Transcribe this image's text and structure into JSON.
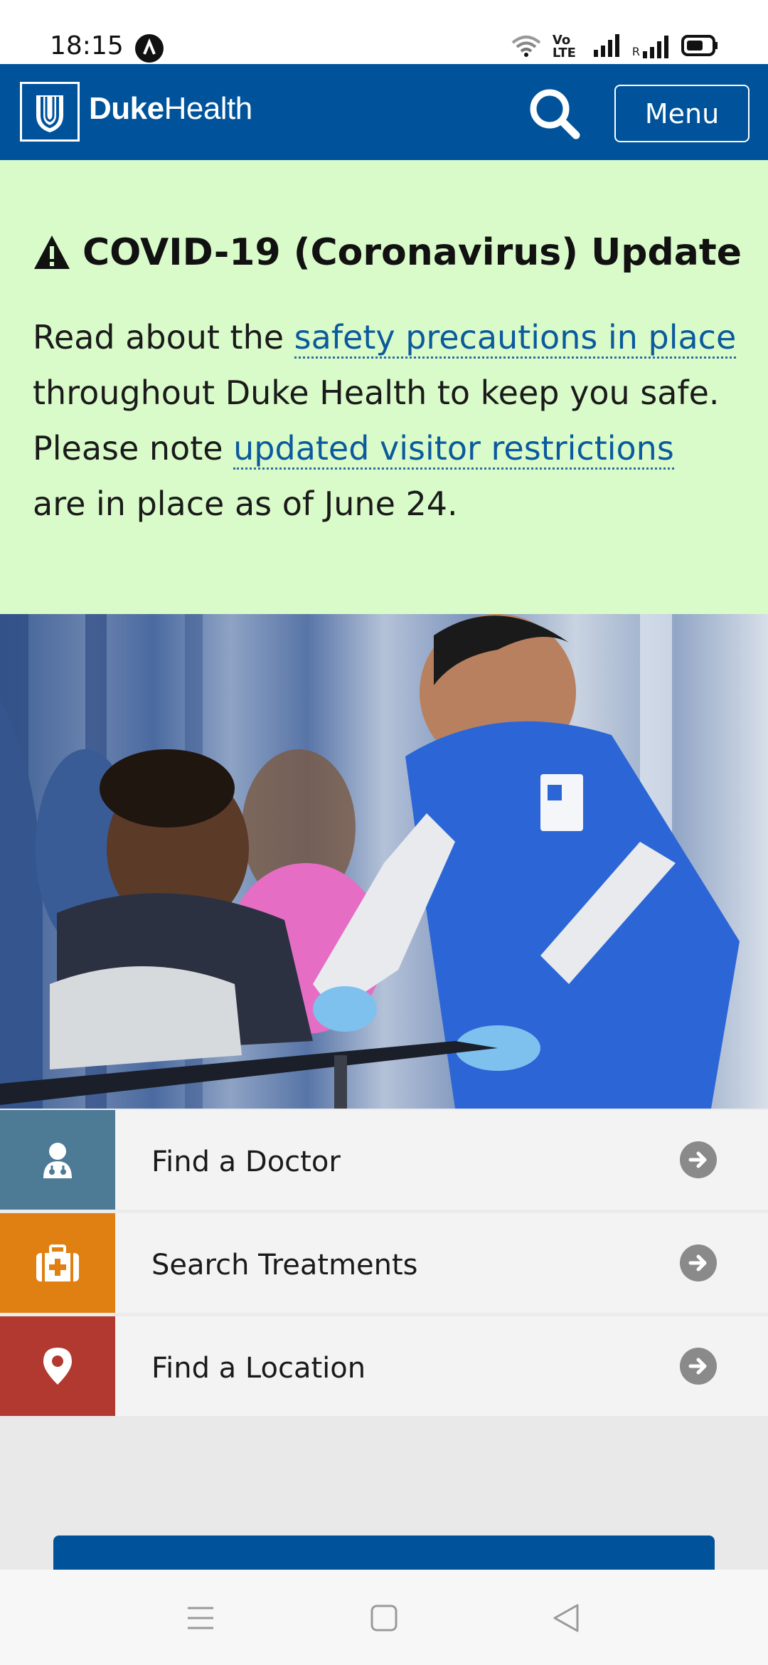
{
  "status_bar": {
    "time": "18:15",
    "icons": [
      "wifi-icon",
      "volte-icon",
      "signal-icon",
      "roaming-signal-icon",
      "battery-icon"
    ],
    "volte_label": "Vo LTE",
    "roaming_label": "R"
  },
  "header": {
    "brand_bold": "Duke",
    "brand_light": "Health",
    "menu_label": "Menu",
    "background": "#00539b"
  },
  "alert": {
    "title": "COVID-19 (Coronavirus) Update",
    "text_1": "Read about the ",
    "link_1": "safety precautions in place",
    "text_2": " throughout Duke Health to keep you safe. Please note ",
    "link_2": "updated visitor restrictions",
    "text_3": " are in place as of June 24.",
    "background": "#d9fbc9"
  },
  "hero": {
    "icon": "photo"
  },
  "quick_links": [
    {
      "label": "Find a Doctor",
      "icon": "doctor-icon",
      "color": "#4d7a95"
    },
    {
      "label": "Search Treatments",
      "icon": "medical-kit-icon",
      "color": "#e07f12"
    },
    {
      "label": "Find a Location",
      "icon": "map-pin-icon",
      "color": "#b2392f"
    }
  ],
  "nav_bar": {
    "buttons": [
      "menu-nav-icon",
      "home-nav-icon",
      "back-nav-icon"
    ]
  }
}
